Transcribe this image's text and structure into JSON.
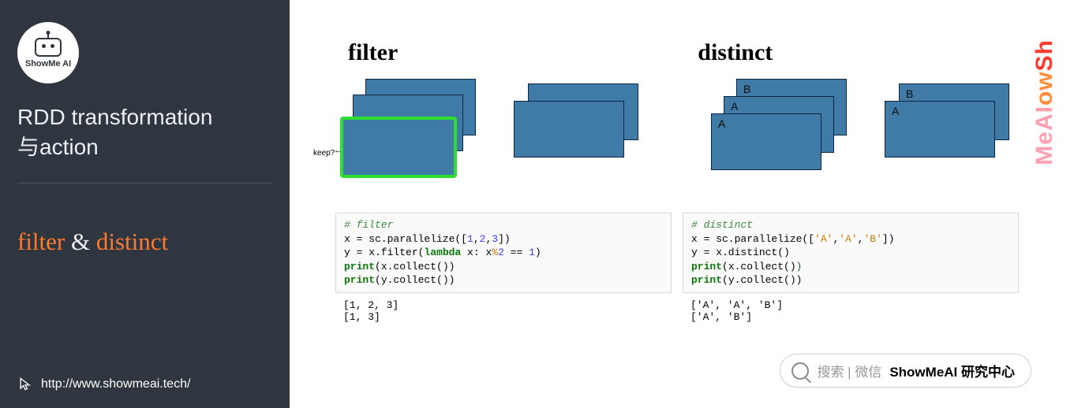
{
  "sidebar": {
    "logo_text": "ShowMe AI",
    "title_line1": "RDD transformation",
    "title_line2": "与action",
    "topic_word1": "filter",
    "topic_amp": "&",
    "topic_word2": "distinct",
    "footer_url": "http://www.showmeai.tech/"
  },
  "content": {
    "heading_left": "filter",
    "heading_right": "distinct",
    "filter_keep_label": "keep?",
    "distinct_cards": {
      "back": "B",
      "mid": "A",
      "front": "A"
    },
    "distinct_result_cards": {
      "back": "B",
      "front": "A"
    }
  },
  "code": {
    "filter": {
      "comment": "# filter",
      "l1_a": "x = sc.parallelize([",
      "l1_n1": "1",
      "l1_c": ",",
      "l1_n2": "2",
      "l1_n3": "3",
      "l1_b": "])",
      "l2_a": "y = x.filter(",
      "l2_kw": "lambda",
      "l2_b": " x: x",
      "l2_mod": "%",
      "l2_c": "2",
      "l2_d": " == ",
      "l2_e": "1",
      "l2_f": ")",
      "l3_kw": "print",
      "l3_b": "(x.collect())",
      "l4_kw": "print",
      "l4_b": "(y.collect())",
      "out1": "[1, 2, 3]",
      "out2": "[1, 3]"
    },
    "distinct": {
      "comment": "# distinct",
      "l1_a": "x = sc.parallelize([",
      "l1_s1": "'A'",
      "l1_c": ",",
      "l1_s2": "'A'",
      "l1_s3": "'B'",
      "l1_b": "])",
      "l2": "y = x.distinct()",
      "l3_kw": "print",
      "l3_b": "(x.collect()",
      "l3_p": ")",
      "l4_kw": "print",
      "l4_b": "(y.collect())",
      "out1": "['A', 'A', 'B']",
      "out2": "['A', 'B']"
    }
  },
  "brand": {
    "p1": "Sh",
    "p2": "ow",
    "p3": "MeAI"
  },
  "search": {
    "gray_text": "搜索 | 微信",
    "bold_text": "ShowMeAI 研究中心"
  }
}
